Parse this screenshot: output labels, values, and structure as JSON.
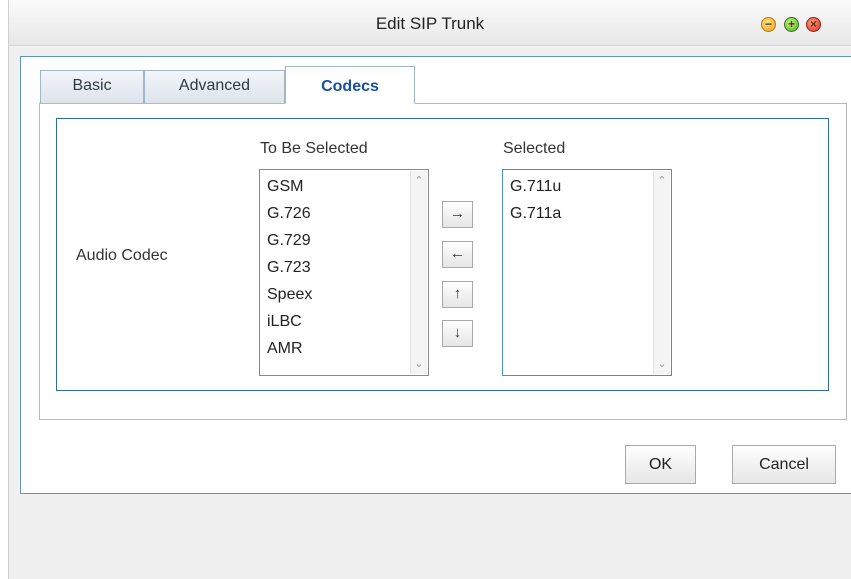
{
  "window": {
    "title": "Edit SIP Trunk",
    "controls": {
      "minimize_glyph": "−",
      "maximize_glyph": "+",
      "close_glyph": "×"
    }
  },
  "tabs": [
    {
      "label": "Basic",
      "active": false
    },
    {
      "label": "Advanced",
      "active": false
    },
    {
      "label": "Codecs",
      "active": true
    }
  ],
  "codecs": {
    "row_label": "Audio Codec",
    "available_label": "To Be Selected",
    "selected_label": "Selected",
    "available": [
      "GSM",
      "G.726",
      "G.729",
      "G.723",
      "Speex",
      "iLBC",
      "AMR"
    ],
    "selected": [
      "G.711u",
      "G.711a"
    ],
    "move_buttons": {
      "right": "→",
      "left": "←",
      "up": "↑",
      "down": "↓"
    }
  },
  "footer": {
    "ok_label": "OK",
    "cancel_label": "Cancel"
  },
  "colors": {
    "accent": "#2f6f95",
    "active_tab_text": "#1a4f9f"
  }
}
